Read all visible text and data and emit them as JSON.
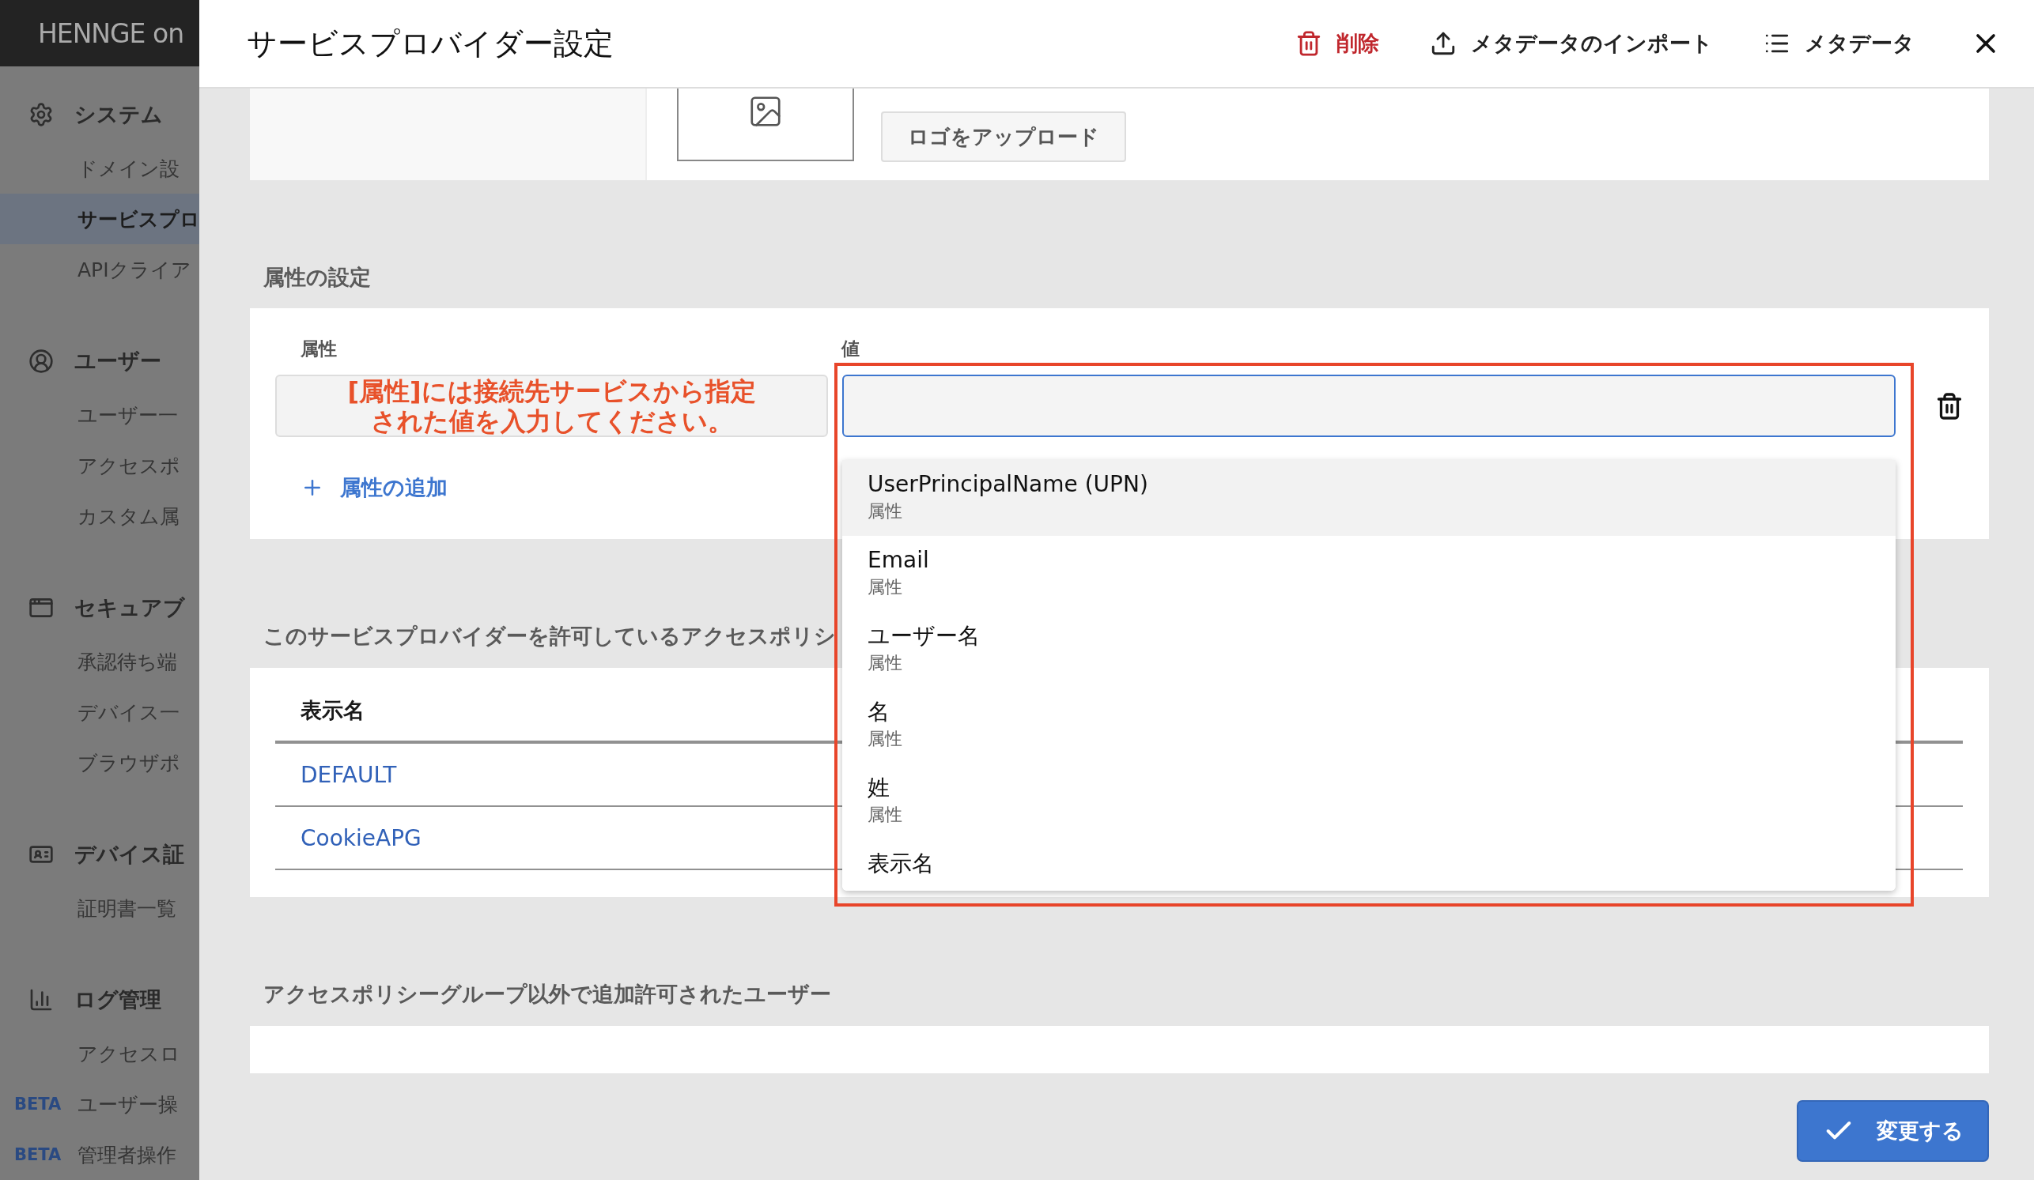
{
  "sidebar": {
    "logo": "HENNGE on",
    "sections": [
      {
        "title": "システム",
        "items": [
          {
            "label": "ドメイン設",
            "selected": false
          },
          {
            "label": "サービスプロ",
            "selected": true
          },
          {
            "label": "APIクライア",
            "selected": false
          }
        ]
      },
      {
        "title": "ユーザー",
        "items": [
          {
            "label": "ユーザー一",
            "selected": false
          },
          {
            "label": "アクセスポ",
            "selected": false
          },
          {
            "label": "カスタム属",
            "selected": false
          }
        ]
      },
      {
        "title": "セキュアブ",
        "items": [
          {
            "label": "承認待ち端",
            "selected": false
          },
          {
            "label": "デバイス一",
            "selected": false
          },
          {
            "label": "ブラウザポ",
            "selected": false
          }
        ]
      },
      {
        "title": "デバイス証",
        "items": [
          {
            "label": "証明書一覧",
            "selected": false
          }
        ]
      },
      {
        "title": "ログ管理",
        "items": [
          {
            "label": "アクセスロ",
            "selected": false
          },
          {
            "label": "ユーザー操",
            "badge": "BETA",
            "selected": false
          },
          {
            "label": "管理者操作",
            "badge": "BETA",
            "selected": false
          }
        ]
      }
    ]
  },
  "header": {
    "title": "サービスプロバイダー設定",
    "actions": [
      {
        "label": "削除",
        "kind": "delete"
      },
      {
        "label": "メタデータのインポート",
        "kind": "import"
      },
      {
        "label": "メタデータ",
        "kind": "list"
      }
    ]
  },
  "logo_upload": {
    "button": "ロゴをアップロード"
  },
  "attributes": {
    "title": "属性の設定",
    "attribute_label": "属性",
    "value_label": "値",
    "annotation": [
      "[属性]には接続先サービスから指定",
      "された値を入力してください。"
    ],
    "add_link": "属性の追加",
    "dropdown": [
      {
        "name": "UserPrincipalName (UPN)",
        "type": "属性",
        "selected": true
      },
      {
        "name": "Email",
        "type": "属性",
        "selected": false
      },
      {
        "name": "ユーザー名",
        "type": "属性",
        "selected": false
      },
      {
        "name": "名",
        "type": "属性",
        "selected": false
      },
      {
        "name": "姓",
        "type": "属性",
        "selected": false
      },
      {
        "name": "表示名",
        "selected": false
      }
    ]
  },
  "policies": {
    "title": "このサービスプロバイダーを許可しているアクセスポリシ",
    "columns": [
      "表示名"
    ],
    "rows": [
      "DEFAULT",
      "CookieAPG"
    ]
  },
  "extra_users": {
    "title": "アクセスポリシーグループ以外で追加許可されたユーザー"
  },
  "save_button": "変更する"
}
